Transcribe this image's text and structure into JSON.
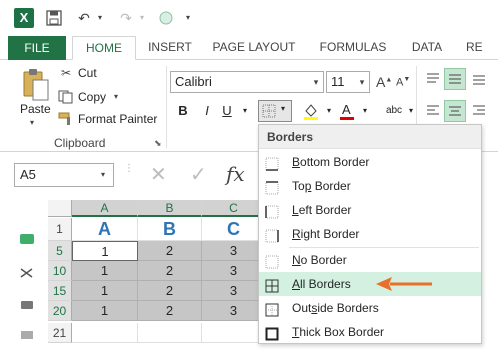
{
  "app": {
    "logo_letter": "X"
  },
  "tabs": [
    "FILE",
    "HOME",
    "INSERT",
    "PAGE LAYOUT",
    "FORMULAS",
    "DATA",
    "RE"
  ],
  "clipboard": {
    "paste_label": "Paste",
    "cut_label": "Cut",
    "copy_label": "Copy",
    "format_painter_label": "Format Painter",
    "group_label": "Clipboard"
  },
  "font": {
    "name": "Calibri",
    "size": "11"
  },
  "namebox": {
    "value": "A5"
  },
  "formula_bar": {
    "cancel": "✕",
    "enter": "✓",
    "fx": "fx"
  },
  "grid": {
    "columns": [
      "A",
      "B",
      "C"
    ],
    "rows": [
      {
        "num": "1",
        "cells": [
          "A",
          "B",
          "C"
        ]
      },
      {
        "num": "5",
        "cells": [
          "1",
          "2",
          "3"
        ]
      },
      {
        "num": "10",
        "cells": [
          "1",
          "2",
          "3"
        ]
      },
      {
        "num": "15",
        "cells": [
          "1",
          "2",
          "3"
        ]
      },
      {
        "num": "20",
        "cells": [
          "1",
          "2",
          "3"
        ]
      },
      {
        "num": "21",
        "cells": [
          "",
          "",
          ""
        ]
      }
    ]
  },
  "borders_menu": {
    "title": "Borders",
    "items": [
      {
        "pre": "",
        "u": "B",
        "post": "ottom Border",
        "icon": "bottom-border-icon"
      },
      {
        "pre": "To",
        "u": "p",
        "post": " Border",
        "icon": "top-border-icon"
      },
      {
        "pre": "",
        "u": "L",
        "post": "eft Border",
        "icon": "left-border-icon"
      },
      {
        "pre": "",
        "u": "R",
        "post": "ight Border",
        "icon": "right-border-icon"
      },
      {
        "pre": "",
        "u": "N",
        "post": "o Border",
        "icon": "no-border-icon"
      },
      {
        "pre": "",
        "u": "A",
        "post": "ll Borders",
        "icon": "all-borders-icon"
      },
      {
        "pre": "Out",
        "u": "s",
        "post": "ide Borders",
        "icon": "outside-borders-icon"
      },
      {
        "pre": "",
        "u": "T",
        "post": "hick Box Border",
        "icon": "thick-box-border-icon"
      }
    ],
    "highlighted": "All Borders"
  },
  "colors": {
    "excel_green": "#217346",
    "selection": "#c6c6c6",
    "highlight": "#d3f0e0",
    "arrow": "#e8702a",
    "header_blue": "#2e75b6"
  }
}
